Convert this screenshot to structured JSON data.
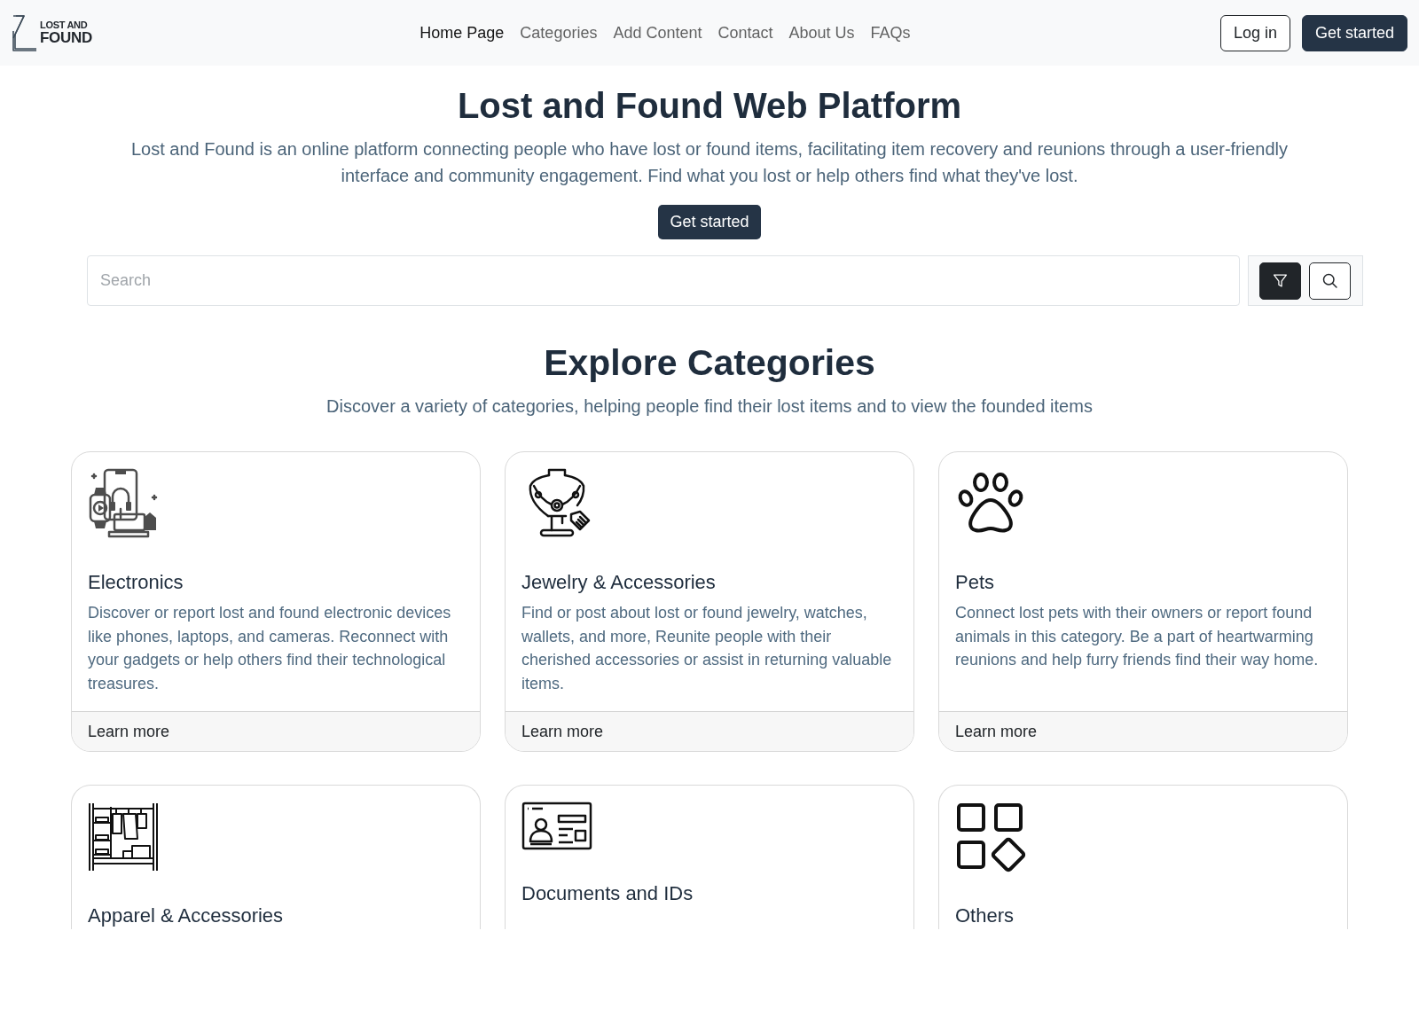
{
  "header": {
    "logo": {
      "line_1": "LOST AND",
      "line_2": "FOUND"
    },
    "nav": [
      {
        "label": "Home Page",
        "selected": true
      },
      {
        "label": "Categories",
        "selected": false
      },
      {
        "label": "Add Content",
        "selected": false
      },
      {
        "label": "Contact",
        "selected": false
      },
      {
        "label": "About Us",
        "selected": false
      },
      {
        "label": "FAQs",
        "selected": false
      }
    ],
    "buttons": [
      {
        "label": "Log in",
        "kind": "outline"
      },
      {
        "label": "Get started",
        "kind": "primary"
      }
    ]
  },
  "hero": {
    "title": "Lost and Found Web Platform",
    "text": "Lost and Found is an online platform connecting people who have lost or found items, facilitating item recovery and reunions through a user-friendly interface and community engagement. Find what you lost or help others find what they've lost.",
    "button": "Get started"
  },
  "search": {
    "placeholder": "Search"
  },
  "categories": {
    "title": "Explore Categories",
    "subtitle": "Discover a variety of categories, helping people find their lost items and to view the founded items",
    "cards": [
      {
        "title": "Electronics",
        "description": "Discover or report lost and found electronic devices like phones, laptops, and cameras. Reconnect with your gadgets or help others find their technological treasures.",
        "link": "Learn more"
      },
      {
        "title": "Jewelry & Accessories",
        "description": "Find or post about lost or found jewelry, watches, wallets, and more, Reunite people with their cherished accessories or assist in returning valuable items.",
        "link": "Learn more"
      },
      {
        "title": "Pets",
        "description": "Connect lost pets with their owners or report found animals in this category. Be a part of heartwarming reunions and help furry friends find their way home.",
        "link": "Learn more"
      },
      {
        "title": "Apparel & Accessories"
      },
      {
        "title": "Documents and IDs"
      },
      {
        "title": "Others"
      }
    ]
  }
}
